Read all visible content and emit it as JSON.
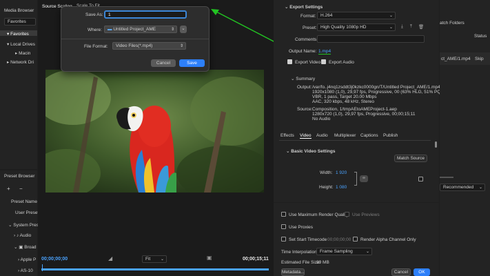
{
  "media_browser": {
    "title": "Media Browser",
    "dropdown": "Favorites",
    "tree": [
      "Favorites",
      "Local Drives",
      "Macin",
      "Network Dri"
    ]
  },
  "preset_browser": {
    "title": "Preset Browser",
    "col": "Preset Name",
    "items": [
      "User Presets",
      "System Presets",
      "Audio",
      "Broad",
      "Apple P",
      "AS-10"
    ]
  },
  "source": {
    "tab": "Source Scaling",
    "tab2": "Scale To Fit",
    "timecode_start": "00;00;00;00",
    "timecode_end": "00;00;15;11",
    "fit": "Fit"
  },
  "save_dialog": {
    "save_as_label": "Save As:",
    "save_as_value": "1",
    "where_label": "Where:",
    "where_value": "Untitled Project_AME",
    "file_format_label": "File Format:",
    "file_format_value": "Video Files(*.mp4)",
    "cancel": "Cancel",
    "save": "Save"
  },
  "export": {
    "title": "Export Settings",
    "format_label": "Format:",
    "format_value": "H.264",
    "preset_label": "Preset:",
    "preset_value": "High Quality 1080p HD",
    "comments_label": "Comments:",
    "output_label": "Output Name:",
    "output_value": "1.mp4",
    "export_video": "Export Video",
    "export_audio": "Export Audio",
    "summary_title": "Summary",
    "output_key": "Output:",
    "output_lines": [
      "/var/fo..j4nq1zsddt3j0kzkc0000gn/T/Untitled Project_AME/1.mp4",
      "1920x1080 (1,0), 29,97 fps, Progressive, 00 (63% HLG, 51% PQ)...",
      "VBR, 1 pass, Target 20.00 Mbps",
      "AAC, 320 kbps, 48 kHz, Stereo"
    ],
    "source_key": "Source:",
    "source_lines": [
      "Composition, 1/tmpAEtoAMEProject-1.aep",
      "1280x720 (1,0), 29,97 fps, Progressive, 00;00;15;11",
      "No Audio"
    ],
    "tabs": [
      "Effects",
      "Video",
      "Audio",
      "Multiplexer",
      "Captions",
      "Publish"
    ],
    "basic_video": "Basic Video Settings",
    "match_source": "Match Source",
    "width_label": "Width:",
    "width_value": "1 920",
    "height_label": "Height:",
    "height_value": "1 080"
  },
  "bottom": {
    "max_render": "Use Maximum Render Quality",
    "use_previews": "Use Previews",
    "use_proxies": "Use Proxies",
    "start_tc": "Set Start Timecode",
    "start_tc_value": "00;00;00;00",
    "render_alpha": "Render Alpha Channel Only",
    "interp_label": "Time Interpolation:",
    "interp_value": "Frame Sampling",
    "size_label": "Estimated File Size:",
    "size_value": "39 MB",
    "metadata": "Metadata...",
    "cancel": "Cancel",
    "ok": "OK"
  },
  "queue": {
    "watch": "atch Folders",
    "status": "Status",
    "item": "ct_AME/1.mp4",
    "skip": "Skip",
    "recommended": "Recommended"
  },
  "colors": {
    "accent": "#2d7ff9",
    "arrow": "#22c322",
    "timeline": "#4aa3ff"
  }
}
